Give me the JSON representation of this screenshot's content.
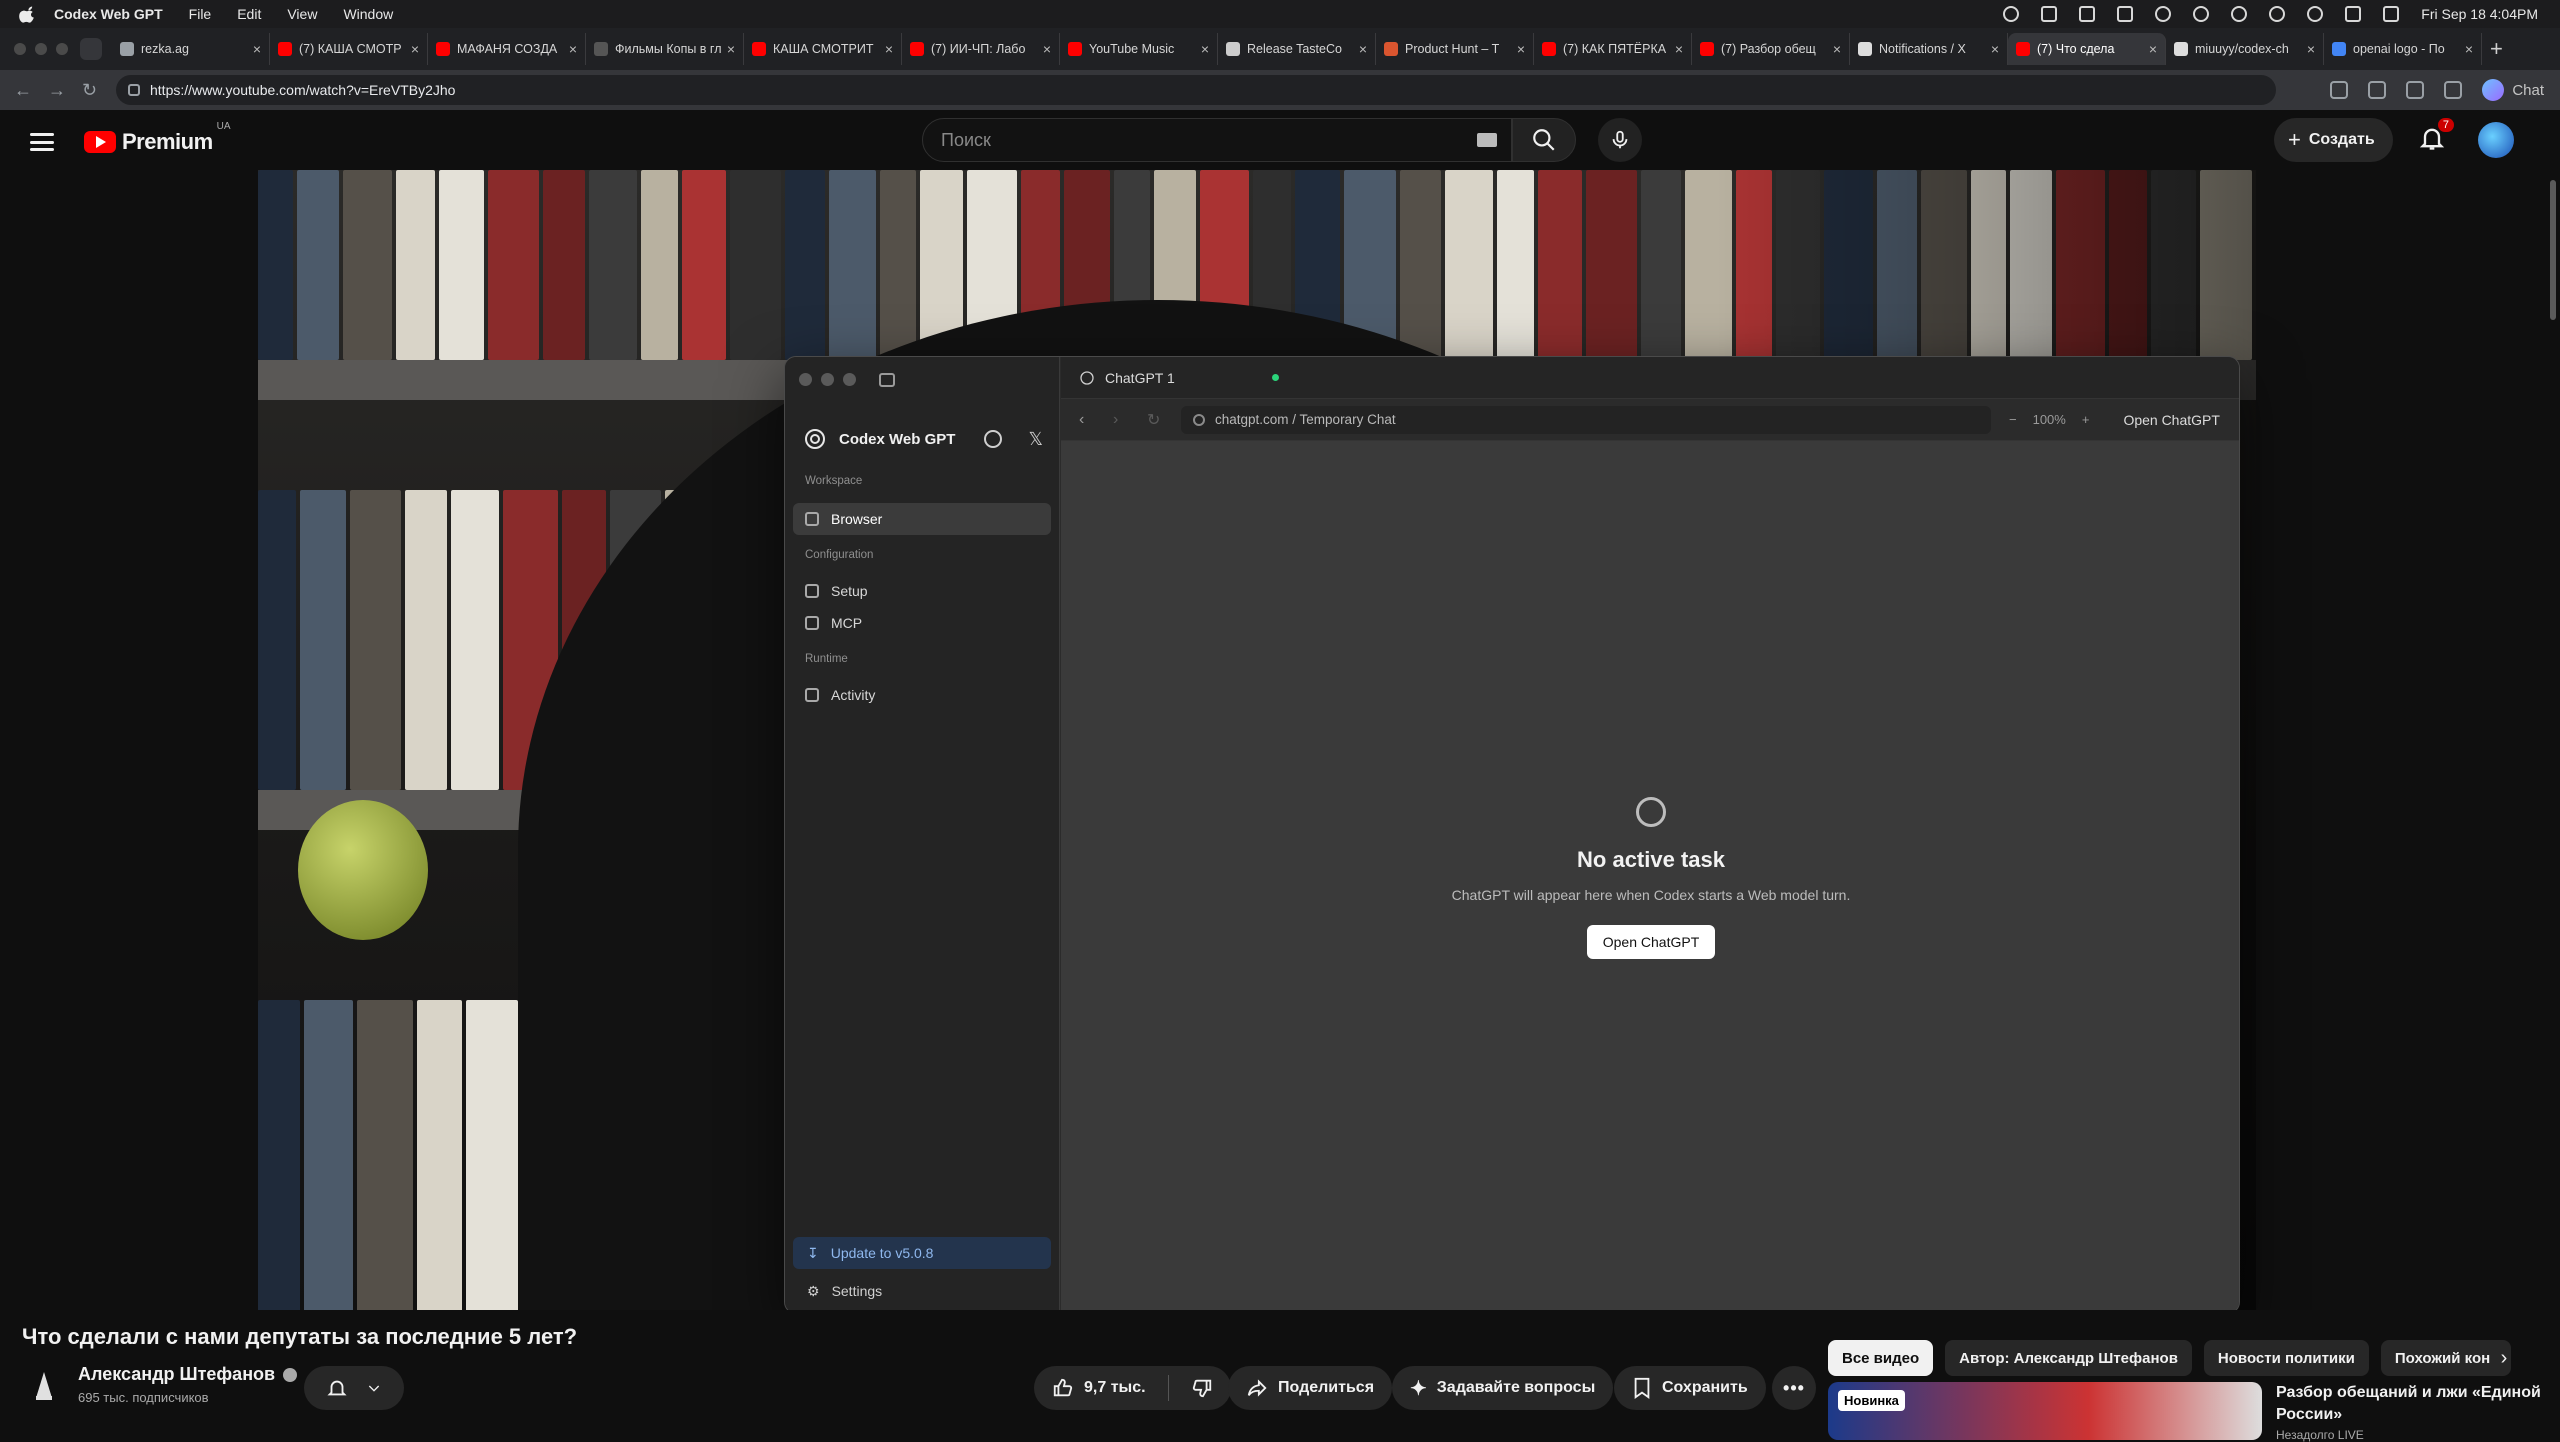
{
  "menubar": {
    "app_name": "Codex Web GPT",
    "items": [
      "File",
      "Edit",
      "View",
      "Window"
    ],
    "clock": "Fri Sep 18  4:04PM"
  },
  "browser_tabs": [
    {
      "title": "rezka.ag",
      "color": "#9aa0a6"
    },
    {
      "title": "(7) КАША СМОТР",
      "color": "#ff0000"
    },
    {
      "title": "МАФАНЯ СОЗДА",
      "color": "#ff0000"
    },
    {
      "title": "Фильмы Копы в гл",
      "color": "#555555"
    },
    {
      "title": "КАША СМОТРИТ",
      "color": "#ff0000"
    },
    {
      "title": "(7) ИИ-ЧП: Лабо",
      "color": "#ff0000"
    },
    {
      "title": "YouTube Music",
      "color": "#ff0000"
    },
    {
      "title": "Release TasteCo",
      "color": "#cccccc"
    },
    {
      "title": "Product Hunt – T",
      "color": "#da552f"
    },
    {
      "title": "(7) КАК ПЯТЁРКА",
      "color": "#ff0000"
    },
    {
      "title": "(7) Разбор обещ",
      "color": "#ff0000"
    },
    {
      "title": "Notifications / X",
      "color": "#dddddd"
    },
    {
      "title": "(7) Что сдела",
      "color": "#ff0000"
    },
    {
      "title": "miuuyy/codex-ch",
      "color": "#dddddd"
    },
    {
      "title": "openai logo - По",
      "color": "#4285f4"
    }
  ],
  "address_bar": {
    "url": "https://www.youtube.com/watch?v=EreVTBy2Jho",
    "chat_label": "Chat"
  },
  "youtube": {
    "brand": "Premium",
    "region": "UA",
    "search_placeholder": "Поиск",
    "create_label": "Создать",
    "notification_count": "7"
  },
  "codex": {
    "app_title": "Codex Web GPT",
    "sections": {
      "workspace": "Workspace",
      "configuration": "Configuration",
      "runtime": "Runtime"
    },
    "nav": {
      "browser": "Browser",
      "setup": "Setup",
      "mcp": "MCP",
      "activity": "Activity"
    },
    "update_label": "Update to v5.0.8",
    "settings_label": "Settings",
    "tab_title": "ChatGPT 1",
    "url_text": "chatgpt.com / Temporary Chat",
    "zoom": "100%",
    "open_chatgpt_label": "Open ChatGPT",
    "empty_title": "No active task",
    "empty_subtitle": "ChatGPT will appear here when Codex starts a Web model turn.",
    "empty_button": "Open ChatGPT"
  },
  "video": {
    "title": "Что сделали с нами депутаты за последние 5 лет?",
    "channel": "Александр Штефанов",
    "subscribers": "695 тыс. подписчиков",
    "likes": "9,7 тыс.",
    "share_label": "Поделиться",
    "ask_label": "Задавайте вопросы",
    "save_label": "Сохранить"
  },
  "chips": [
    "Все видео",
    "Автор: Александр Штефанов",
    "Новости политики",
    "Похожий кон"
  ],
  "recommendation": {
    "badge": "Новинка",
    "title": "Разбор обещаний и лжи «Единой России»",
    "meta": "Незадолго LIVE"
  }
}
